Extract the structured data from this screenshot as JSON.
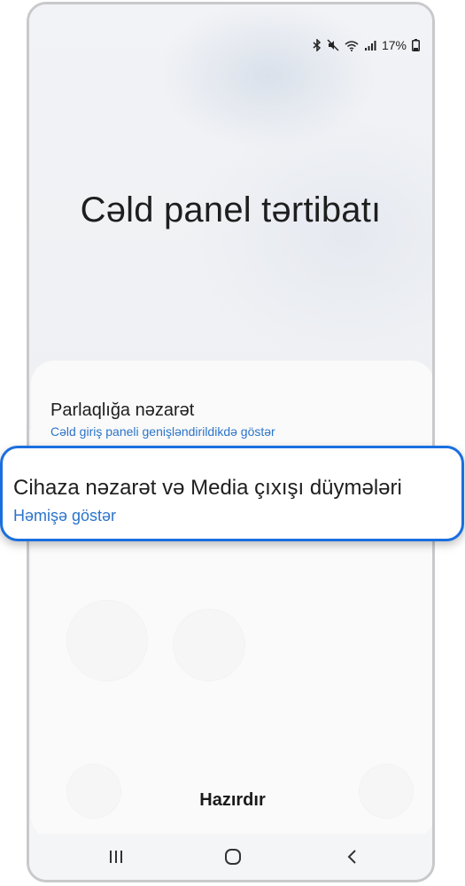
{
  "status_bar": {
    "battery_percent": "17%",
    "icons": [
      "bluetooth-icon",
      "mute-icon",
      "wifi-icon",
      "signal-icon",
      "battery-icon"
    ]
  },
  "page": {
    "title": "Cəld panel tərtibatı"
  },
  "settings": {
    "brightness": {
      "title": "Parlaqlığa nəzarət",
      "value": "Cəld giriş paneli genişləndirildikdə göstər"
    },
    "device_media": {
      "title": "Cihaza nəzarət və Media çıxışı düyməl​əri",
      "value": "Həmişə göstər"
    }
  },
  "actions": {
    "done_label": "Hazırdır"
  },
  "nav": {
    "items": [
      "recents-icon",
      "home-icon",
      "back-icon"
    ]
  },
  "colors": {
    "accent": "#2b74c9",
    "highlight_border": "#1a6fdf"
  }
}
